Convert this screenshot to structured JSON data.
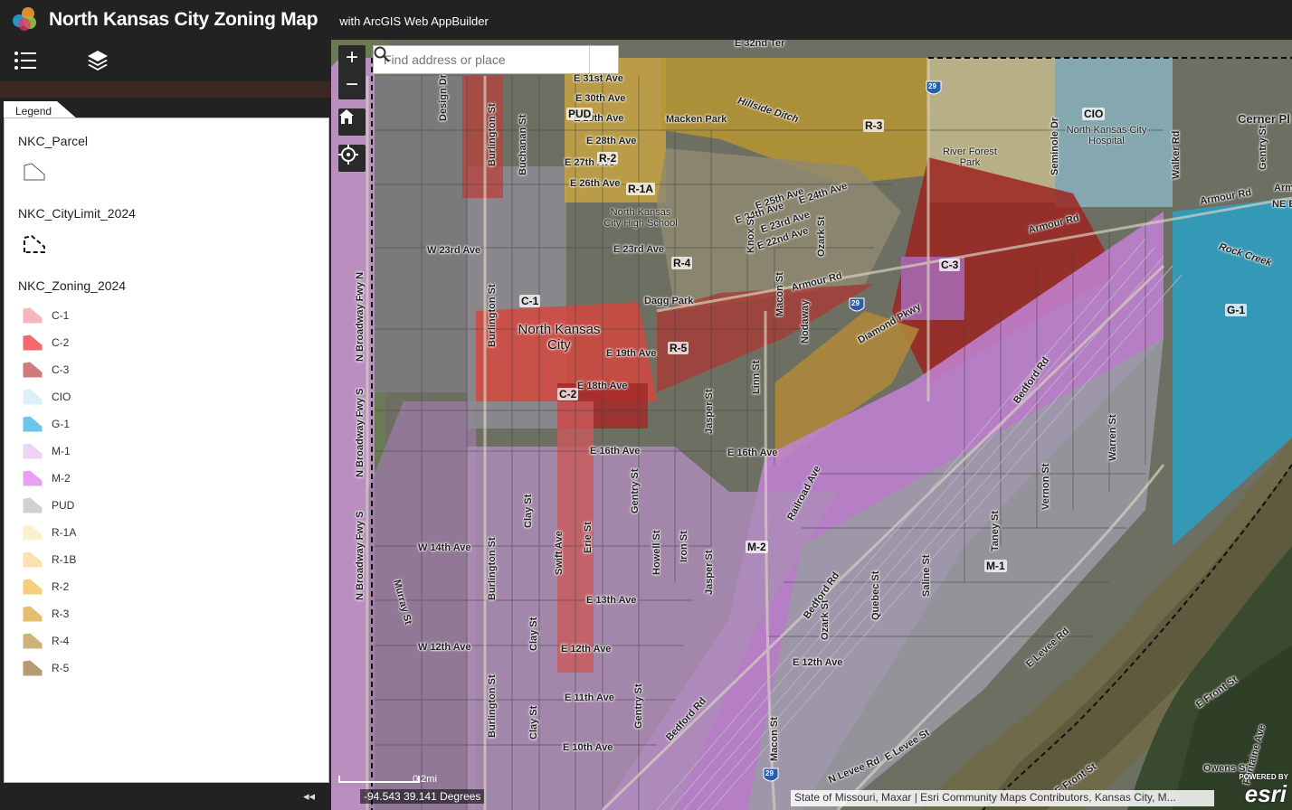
{
  "header": {
    "title": "North Kansas City Zoning Map",
    "subtitle": "with ArcGIS Web AppBuilder"
  },
  "panel": {
    "legend_icon": "legend-list-icon",
    "layers_icon": "layers-icon",
    "tab_label": "Legend",
    "layers": [
      {
        "title": "NKC_Parcel"
      },
      {
        "title": "NKC_CityLimit_2024"
      },
      {
        "title": "NKC_Zoning_2024"
      }
    ],
    "zoning": [
      {
        "label": "C-1",
        "color": "#f6b6be"
      },
      {
        "label": "C-2",
        "color": "#f26a6e"
      },
      {
        "label": "C-3",
        "color": "#cd7b7d"
      },
      {
        "label": "CIO",
        "color": "#dcf0fa"
      },
      {
        "label": "G-1",
        "color": "#6cc6ea"
      },
      {
        "label": "M-1",
        "color": "#efd3f5"
      },
      {
        "label": "M-2",
        "color": "#e4a2ef"
      },
      {
        "label": "PUD",
        "color": "#d0d0d0"
      },
      {
        "label": "R-1A",
        "color": "#fdf0cf"
      },
      {
        "label": "R-1B",
        "color": "#fbe0b0"
      },
      {
        "label": "R-2",
        "color": "#f6cd7b"
      },
      {
        "label": "R-3",
        "color": "#e6bd6d"
      },
      {
        "label": "R-4",
        "color": "#cfb27a"
      },
      {
        "label": "R-5",
        "color": "#b59a74"
      }
    ],
    "collapse": "◂◂"
  },
  "map": {
    "search_placeholder": "Find address or place",
    "zoom_in": "+",
    "zoom_out": "−",
    "coords": "-94.543 39.141 Degrees",
    "scale": "0.2mi",
    "attribution": "State of Missouri, Maxar | Esri Community Maps Contributors, Kansas City, M...",
    "powered": "POWERED BY",
    "esri": "esri",
    "streets": [
      {
        "text": "E 32nd Ter"
      },
      {
        "text": "E 31st Ave"
      },
      {
        "text": "E 30th Ave"
      },
      {
        "text": "E 29th Ave"
      },
      {
        "text": "E 28th Ave"
      },
      {
        "text": "E 27th Ave"
      },
      {
        "text": "E 26th Ave"
      },
      {
        "text": "E 25th Ave"
      },
      {
        "text": "E 24th Ave"
      },
      {
        "text": "E 24th Ave"
      },
      {
        "text": "E 23rd Ave"
      },
      {
        "text": "E 23rd Ave"
      },
      {
        "text": "E 22nd Ave"
      },
      {
        "text": "W 23rd Ave"
      },
      {
        "text": "E 19th Ave"
      },
      {
        "text": "E 18th Ave"
      },
      {
        "text": "E 16th Ave"
      },
      {
        "text": "E 16th Ave"
      },
      {
        "text": "W 14th Ave"
      },
      {
        "text": "E 13th Ave"
      },
      {
        "text": "W 12th Ave"
      },
      {
        "text": "E 12th Ave"
      },
      {
        "text": "E 12th Ave"
      },
      {
        "text": "E 11th Ave"
      },
      {
        "text": "E 10th Ave"
      },
      {
        "text": "Armour Rd"
      },
      {
        "text": "Armour Rd"
      },
      {
        "text": "Armour Rd"
      },
      {
        "text": "Diamond Pkwy"
      },
      {
        "text": "Dagg Park"
      },
      {
        "text": "Macken Park"
      },
      {
        "text": "Hillside Ditch"
      },
      {
        "text": "Rock Creek"
      },
      {
        "text": "Design Dr"
      },
      {
        "text": "Burlington St"
      },
      {
        "text": "Burlington St"
      },
      {
        "text": "Burlington St"
      },
      {
        "text": "Burlington St"
      },
      {
        "text": "Buchanan St"
      },
      {
        "text": "N Broadway Fwy N"
      },
      {
        "text": "N Broadway Fwy S"
      },
      {
        "text": "N Broadway Fwy S"
      },
      {
        "text": "Murray St"
      },
      {
        "text": "Clay St"
      },
      {
        "text": "Clay St"
      },
      {
        "text": "Clay St"
      },
      {
        "text": "Swift Ave"
      },
      {
        "text": "Erie St"
      },
      {
        "text": "Gentry St"
      },
      {
        "text": "Gentry St"
      },
      {
        "text": "Howell St"
      },
      {
        "text": "Iron St"
      },
      {
        "text": "Jasper St"
      },
      {
        "text": "Jasper St"
      },
      {
        "text": "Linn St"
      },
      {
        "text": "Knox St"
      },
      {
        "text": "Macon St"
      },
      {
        "text": "Macon St"
      },
      {
        "text": "Nodaway"
      },
      {
        "text": "Ozark St"
      },
      {
        "text": "Ozark St"
      },
      {
        "text": "Quebec St"
      },
      {
        "text": "Saline St"
      },
      {
        "text": "Taney St"
      },
      {
        "text": "Vernon St"
      },
      {
        "text": "Warren St"
      },
      {
        "text": "Railroad Ave"
      },
      {
        "text": "Bedford Rd"
      },
      {
        "text": "Bedford Rd"
      },
      {
        "text": "Bedford Rd"
      },
      {
        "text": "E Levee Rd"
      },
      {
        "text": "E Levee St"
      },
      {
        "text": "N Levee Rd"
      },
      {
        "text": "Seminole Dr"
      },
      {
        "text": "Walker Rd"
      },
      {
        "text": "Gentry St"
      },
      {
        "text": "E Front St"
      },
      {
        "text": "E Front St"
      },
      {
        "text": "Owens St"
      },
      {
        "text": "Fontaine Ave"
      },
      {
        "text": "Armour Rd"
      },
      {
        "text": "NE B"
      },
      {
        "text": "Armo"
      },
      {
        "text": "Cerner Pl"
      }
    ],
    "zones": [
      {
        "text": "R-3"
      },
      {
        "text": "R-2"
      },
      {
        "text": "R-1A"
      },
      {
        "text": "R-4"
      },
      {
        "text": "R-5"
      },
      {
        "text": "C-1"
      },
      {
        "text": "C-2"
      },
      {
        "text": "C-3"
      },
      {
        "text": "G-1"
      },
      {
        "text": "M-2"
      },
      {
        "text": "M-1"
      },
      {
        "text": "CIO"
      },
      {
        "text": "PUD"
      }
    ],
    "places": [
      {
        "text": "North Kansas City High School"
      },
      {
        "text": "River Forest Park"
      },
      {
        "text": "North Kansas City Hospital"
      }
    ],
    "city": "North Kansas City",
    "shields": [
      "29",
      "29",
      "29"
    ]
  }
}
